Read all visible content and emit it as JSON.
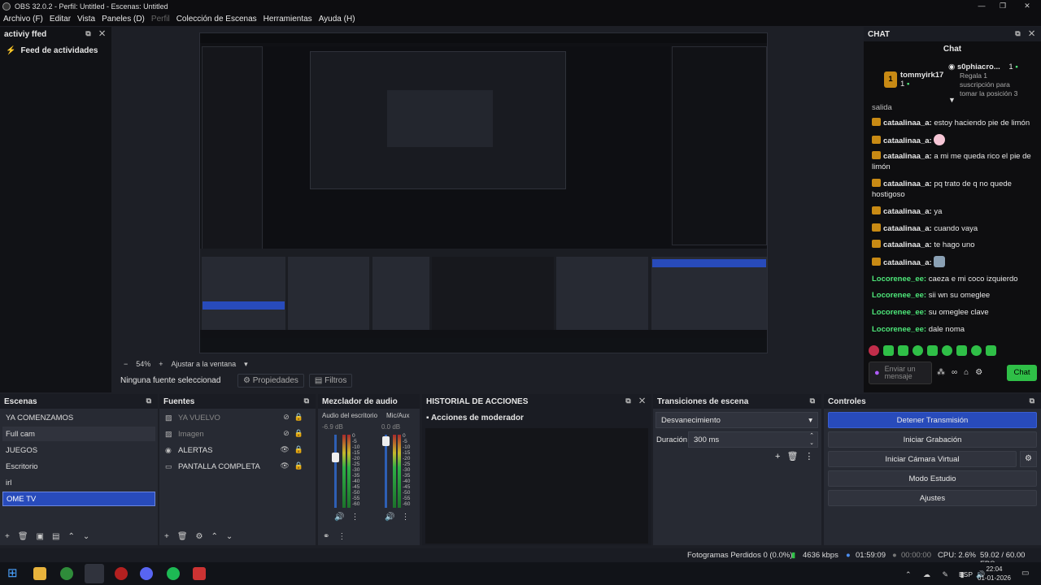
{
  "window": {
    "title": "OBS 32.0.2 - Perfil: Untitled - Escenas: Untitled"
  },
  "menu": [
    {
      "label": "Archivo (F)",
      "disabled": false
    },
    {
      "label": "Editar",
      "disabled": false
    },
    {
      "label": "Vista",
      "disabled": false
    },
    {
      "label": "Paneles (D)",
      "disabled": false
    },
    {
      "label": "Perfil",
      "disabled": true
    },
    {
      "label": "Colección de Escenas",
      "disabled": false
    },
    {
      "label": "Herramientas",
      "disabled": false
    },
    {
      "label": "Ayuda (H)",
      "disabled": false
    }
  ],
  "activity": {
    "dock_title": "activiy ffed",
    "feed_label": "Feed de actividades"
  },
  "preview_bar": {
    "zoom": "54%",
    "fit_label": "Ajustar a la ventana",
    "no_source": "Ninguna fuente seleccionad",
    "properties": "Propiedades",
    "filters": "Filtros"
  },
  "scenes": {
    "title": "Escenas",
    "items": [
      {
        "label": "YA COMENZAMOS"
      },
      {
        "label": "Full cam"
      },
      {
        "label": "JUEGOS"
      },
      {
        "label": "Escritorio"
      },
      {
        "label": "irl"
      },
      {
        "label": "OME TV"
      }
    ]
  },
  "sources": {
    "title": "Fuentes",
    "items": [
      {
        "label": "YA VUELVO",
        "hidden": true
      },
      {
        "label": "Imagen",
        "hidden": true
      },
      {
        "label": "ALERTAS",
        "hidden": false
      },
      {
        "label": "PANTALLA COMPLETA",
        "hidden": false
      }
    ]
  },
  "mixer": {
    "title": "Mezclador de audio",
    "channels": [
      {
        "name": "Audio del escritorio",
        "db": "-6.9 dB",
        "level": 0.62
      },
      {
        "name": "Mic/Aux",
        "db": "0.0 dB",
        "level": 0.7
      }
    ],
    "scale": [
      "0",
      "-5",
      "-10",
      "-15",
      "-20",
      "-25",
      "-30",
      "-35",
      "-40",
      "-45",
      "-50",
      "-55",
      "-60"
    ]
  },
  "history": {
    "title": "HISTORIAL DE ACCIONES",
    "header": "Acciones de moderador"
  },
  "transitions": {
    "title": "Transiciones de escena",
    "selected": "Desvanecimiento",
    "duration_label": "Duración",
    "duration_value": "300 ms"
  },
  "controls": {
    "title": "Controles",
    "buttons": [
      "Detener Transmisión",
      "Iniciar Grabación",
      "Iniciar Cámara Virtual",
      "Modo Estudio",
      "Ajustes"
    ]
  },
  "chat": {
    "dock_title": "CHAT",
    "header": "Chat",
    "pinned_left": {
      "user": "tommyirk17",
      "count": "1"
    },
    "pinned_right": {
      "user": "s0phiacro...",
      "count": "1",
      "line1": "Regala 1",
      "line2": "suscripción para",
      "line3": "tomar la posición 3"
    },
    "cut_text": "salida",
    "messages": [
      {
        "user": "cataalinaa_a:",
        "text": "estoy haciendo pie de limón",
        "badge": true
      },
      {
        "user": "cataalinaa_a:",
        "text": "",
        "badge": true,
        "emote": true
      },
      {
        "user": "cataalinaa_a:",
        "text": "a mi me queda rico el pie de limón",
        "badge": true
      },
      {
        "user": "cataalinaa_a:",
        "text": "pq trato de q no quede hostigoso",
        "badge": true
      },
      {
        "user": "cataalinaa_a:",
        "text": "ya",
        "badge": true
      },
      {
        "user": "cataalinaa_a:",
        "text": "cuando vaya",
        "badge": true
      },
      {
        "user": "cataalinaa_a:",
        "text": "te hago uno",
        "badge": true
      },
      {
        "user": "cataalinaa_a:",
        "text": "",
        "badge": true,
        "emote": true
      },
      {
        "user": "Locorenee_ee:",
        "text": "caeza e mi coco izquierdo",
        "badge": false
      },
      {
        "user": "Locorenee_ee:",
        "text": "sii wn su omeglee",
        "badge": false
      },
      {
        "user": "Locorenee_ee:",
        "text": "su omeglee clave",
        "badge": false
      },
      {
        "user": "Locorenee_ee:",
        "text": "dale noma",
        "badge": false
      }
    ],
    "input_placeholder": "Enviar un mensaje",
    "send_label": "Chat"
  },
  "status": {
    "dropped": "Fotogramas Perdidos 0 (0.0%)",
    "bitrate": "4636 kbps",
    "stream_time": "01:59:09",
    "rec_time": "00:00:00",
    "cpu": "CPU: 2.6%",
    "fps": "59.02 / 60.00 FPS"
  },
  "taskbar": {
    "lang": "ESP",
    "time": "22:04",
    "date": "01-01-2026"
  },
  "colors": {
    "accent": "#284bbb",
    "panel": "#272a33",
    "chat_green": "#4ee87a"
  }
}
